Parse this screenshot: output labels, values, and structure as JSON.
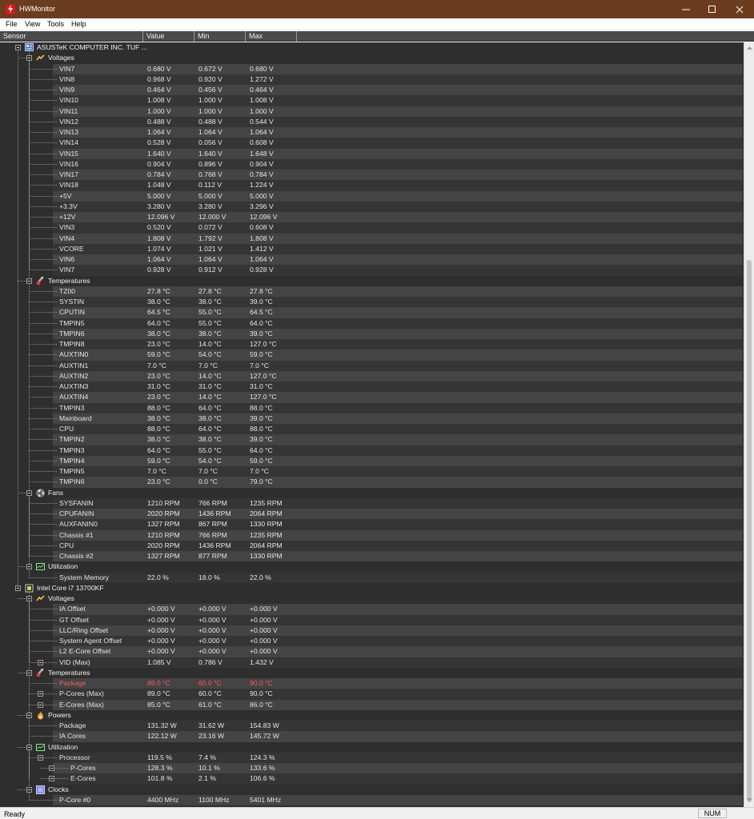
{
  "window": {
    "title": "HWMonitor"
  },
  "menu": [
    "File",
    "View",
    "Tools",
    "Help"
  ],
  "columns": {
    "sensor": "Sensor",
    "value": "Value",
    "min": "Min",
    "max": "Max"
  },
  "tree": [
    {
      "type": "device",
      "level": 0,
      "icon": "motherboard-icon",
      "label": "ASUSTeK COMPUTER INC. TUF ..."
    },
    {
      "type": "group",
      "level": 1,
      "icon": "voltage-icon",
      "label": "Voltages"
    },
    {
      "type": "sensor",
      "level": 2,
      "label": "VIN7",
      "value": "0.680 V",
      "min": "0.672 V",
      "max": "0.680 V"
    },
    {
      "type": "sensor",
      "level": 2,
      "label": "VIN8",
      "value": "0.968 V",
      "min": "0.920 V",
      "max": "1.272 V"
    },
    {
      "type": "sensor",
      "level": 2,
      "label": "VIN9",
      "value": "0.464 V",
      "min": "0.456 V",
      "max": "0.464 V"
    },
    {
      "type": "sensor",
      "level": 2,
      "label": "VIN10",
      "value": "1.008 V",
      "min": "1.000 V",
      "max": "1.008 V"
    },
    {
      "type": "sensor",
      "level": 2,
      "label": "VIN11",
      "value": "1.000 V",
      "min": "1.000 V",
      "max": "1.000 V"
    },
    {
      "type": "sensor",
      "level": 2,
      "label": "VIN12",
      "value": "0.488 V",
      "min": "0.488 V",
      "max": "0.544 V"
    },
    {
      "type": "sensor",
      "level": 2,
      "label": "VIN13",
      "value": "1.064 V",
      "min": "1.064 V",
      "max": "1.064 V"
    },
    {
      "type": "sensor",
      "level": 2,
      "label": "VIN14",
      "value": "0.528 V",
      "min": "0.056 V",
      "max": "0.608 V"
    },
    {
      "type": "sensor",
      "level": 2,
      "label": "VIN15",
      "value": "1.640 V",
      "min": "1.640 V",
      "max": "1.648 V"
    },
    {
      "type": "sensor",
      "level": 2,
      "label": "VIN16",
      "value": "0.904 V",
      "min": "0.896 V",
      "max": "0.904 V"
    },
    {
      "type": "sensor",
      "level": 2,
      "label": "VIN17",
      "value": "0.784 V",
      "min": "0.768 V",
      "max": "0.784 V"
    },
    {
      "type": "sensor",
      "level": 2,
      "label": "VIN18",
      "value": "1.048 V",
      "min": "0.112 V",
      "max": "1.224 V"
    },
    {
      "type": "sensor",
      "level": 2,
      "label": "+5V",
      "value": "5.000 V",
      "min": "5.000 V",
      "max": "5.000 V"
    },
    {
      "type": "sensor",
      "level": 2,
      "label": "+3.3V",
      "value": "3.280 V",
      "min": "3.280 V",
      "max": "3.296 V"
    },
    {
      "type": "sensor",
      "level": 2,
      "label": "+12V",
      "value": "12.096 V",
      "min": "12.000 V",
      "max": "12.096 V"
    },
    {
      "type": "sensor",
      "level": 2,
      "label": "VIN3",
      "value": "0.520 V",
      "min": "0.072 V",
      "max": "0.608 V"
    },
    {
      "type": "sensor",
      "level": 2,
      "label": "VIN4",
      "value": "1.808 V",
      "min": "1.792 V",
      "max": "1.808 V"
    },
    {
      "type": "sensor",
      "level": 2,
      "label": "VCORE",
      "value": "1.074 V",
      "min": "1.021 V",
      "max": "1.412 V"
    },
    {
      "type": "sensor",
      "level": 2,
      "label": "VIN6",
      "value": "1.064 V",
      "min": "1.064 V",
      "max": "1.064 V"
    },
    {
      "type": "sensor",
      "level": 2,
      "label": "VIN7",
      "value": "0.928 V",
      "min": "0.912 V",
      "max": "0.928 V"
    },
    {
      "type": "group",
      "level": 1,
      "icon": "thermometer-icon",
      "label": "Temperatures"
    },
    {
      "type": "sensor",
      "level": 2,
      "label": "TZ00",
      "value": "27.8 °C",
      "min": "27.8 °C",
      "max": "27.8 °C"
    },
    {
      "type": "sensor",
      "level": 2,
      "label": "SYSTIN",
      "value": "38.0 °C",
      "min": "38.0 °C",
      "max": "39.0 °C"
    },
    {
      "type": "sensor",
      "level": 2,
      "label": "CPUTIN",
      "value": "64.5 °C",
      "min": "55.0 °C",
      "max": "64.5 °C"
    },
    {
      "type": "sensor",
      "level": 2,
      "label": "TMPIN5",
      "value": "64.0 °C",
      "min": "55.0 °C",
      "max": "64.0 °C"
    },
    {
      "type": "sensor",
      "level": 2,
      "label": "TMPIN6",
      "value": "38.0 °C",
      "min": "38.0 °C",
      "max": "39.0 °C"
    },
    {
      "type": "sensor",
      "level": 2,
      "label": "TMPIN8",
      "value": "23.0 °C",
      "min": "14.0 °C",
      "max": "127.0 °C"
    },
    {
      "type": "sensor",
      "level": 2,
      "label": "AUXTIN0",
      "value": "59.0 °C",
      "min": "54.0 °C",
      "max": "59.0 °C"
    },
    {
      "type": "sensor",
      "level": 2,
      "label": "AUXTIN1",
      "value": "7.0 °C",
      "min": "7.0 °C",
      "max": "7.0 °C"
    },
    {
      "type": "sensor",
      "level": 2,
      "label": "AUXTIN2",
      "value": "23.0 °C",
      "min": "14.0 °C",
      "max": "127.0 °C"
    },
    {
      "type": "sensor",
      "level": 2,
      "label": "AUXTIN3",
      "value": "31.0 °C",
      "min": "31.0 °C",
      "max": "31.0 °C"
    },
    {
      "type": "sensor",
      "level": 2,
      "label": "AUXTIN4",
      "value": "23.0 °C",
      "min": "14.0 °C",
      "max": "127.0 °C"
    },
    {
      "type": "sensor",
      "level": 2,
      "label": "TMPIN3",
      "value": "88.0 °C",
      "min": "64.0 °C",
      "max": "88.0 °C"
    },
    {
      "type": "sensor",
      "level": 2,
      "label": "Mainboard",
      "value": "38.0 °C",
      "min": "38.0 °C",
      "max": "39.0 °C"
    },
    {
      "type": "sensor",
      "level": 2,
      "label": "CPU",
      "value": "88.0 °C",
      "min": "64.0 °C",
      "max": "88.0 °C"
    },
    {
      "type": "sensor",
      "level": 2,
      "label": "TMPIN2",
      "value": "38.0 °C",
      "min": "38.0 °C",
      "max": "39.0 °C"
    },
    {
      "type": "sensor",
      "level": 2,
      "label": "TMPIN3",
      "value": "64.0 °C",
      "min": "55.0 °C",
      "max": "64.0 °C"
    },
    {
      "type": "sensor",
      "level": 2,
      "label": "TMPIN4",
      "value": "59.0 °C",
      "min": "54.0 °C",
      "max": "59.0 °C"
    },
    {
      "type": "sensor",
      "level": 2,
      "label": "TMPIN5",
      "value": "7.0 °C",
      "min": "7.0 °C",
      "max": "7.0 °C"
    },
    {
      "type": "sensor",
      "level": 2,
      "label": "TMPIN6",
      "value": "23.0 °C",
      "min": "0.0 °C",
      "max": "79.0 °C"
    },
    {
      "type": "group",
      "level": 1,
      "icon": "fan-icon",
      "label": "Fans"
    },
    {
      "type": "sensor",
      "level": 2,
      "label": "SYSFANIN",
      "value": "1210 RPM",
      "min": "766 RPM",
      "max": "1235 RPM"
    },
    {
      "type": "sensor",
      "level": 2,
      "label": "CPUFANIN",
      "value": "2020 RPM",
      "min": "1436 RPM",
      "max": "2064 RPM"
    },
    {
      "type": "sensor",
      "level": 2,
      "label": "AUXFANIN0",
      "value": "1327 RPM",
      "min": "867 RPM",
      "max": "1330 RPM"
    },
    {
      "type": "sensor",
      "level": 2,
      "label": "Chassis #1",
      "value": "1210 RPM",
      "min": "766 RPM",
      "max": "1235 RPM"
    },
    {
      "type": "sensor",
      "level": 2,
      "label": "CPU",
      "value": "2020 RPM",
      "min": "1436 RPM",
      "max": "2064 RPM"
    },
    {
      "type": "sensor",
      "level": 2,
      "label": "Chassis #2",
      "value": "1327 RPM",
      "min": "877 RPM",
      "max": "1330 RPM"
    },
    {
      "type": "group",
      "level": 1,
      "icon": "utilization-icon",
      "label": "Utilization"
    },
    {
      "type": "sensor",
      "level": 2,
      "label": "System Memory",
      "value": "22.0 %",
      "min": "18.0 %",
      "max": "22.0 %"
    },
    {
      "type": "device",
      "level": 0,
      "icon": "cpu-icon",
      "label": "Intel Core i7 13700KF"
    },
    {
      "type": "group",
      "level": 1,
      "icon": "voltage-icon",
      "label": "Voltages"
    },
    {
      "type": "sensor",
      "level": 2,
      "label": "IA Offset",
      "value": "+0.000 V",
      "min": "+0.000 V",
      "max": "+0.000 V"
    },
    {
      "type": "sensor",
      "level": 2,
      "label": "GT Offset",
      "value": "+0.000 V",
      "min": "+0.000 V",
      "max": "+0.000 V"
    },
    {
      "type": "sensor",
      "level": 2,
      "label": "LLC/Ring Offset",
      "value": "+0.000 V",
      "min": "+0.000 V",
      "max": "+0.000 V"
    },
    {
      "type": "sensor",
      "level": 2,
      "label": "System Agent Offset",
      "value": "+0.000 V",
      "min": "+0.000 V",
      "max": "+0.000 V"
    },
    {
      "type": "sensor",
      "level": 2,
      "label": "L2 E-Core Offset",
      "value": "+0.000 V",
      "min": "+0.000 V",
      "max": "+0.000 V"
    },
    {
      "type": "sensor",
      "level": 2,
      "expandable": true,
      "label": "VID (Max)",
      "value": "1.085 V",
      "min": "0.786 V",
      "max": "1.432 V"
    },
    {
      "type": "group",
      "level": 1,
      "icon": "thermometer-icon",
      "label": "Temperatures"
    },
    {
      "type": "sensor",
      "level": 2,
      "alert": true,
      "label": "Package",
      "value": "89.0 °C",
      "min": "60.0 °C",
      "max": "90.0 °C"
    },
    {
      "type": "sensor",
      "level": 2,
      "expandable": true,
      "label": "P-Cores (Max)",
      "value": "89.0 °C",
      "min": "60.0 °C",
      "max": "90.0 °C"
    },
    {
      "type": "sensor",
      "level": 2,
      "expandable": true,
      "label": "E-Cores (Max)",
      "value": "85.0 °C",
      "min": "61.0 °C",
      "max": "86.0 °C"
    },
    {
      "type": "group",
      "level": 1,
      "icon": "flame-icon",
      "label": "Powers"
    },
    {
      "type": "sensor",
      "level": 2,
      "label": "Package",
      "value": "131.32 W",
      "min": "31.62 W",
      "max": "154.83 W"
    },
    {
      "type": "sensor",
      "level": 2,
      "label": "IA Cores",
      "value": "122.12 W",
      "min": "23.16 W",
      "max": "145.72 W"
    },
    {
      "type": "group",
      "level": 1,
      "icon": "utilization-icon",
      "label": "Utilization"
    },
    {
      "type": "sensor",
      "level": 2,
      "expandable": true,
      "label": "Processor",
      "value": "119.5 %",
      "min": "7.4 %",
      "max": "124.3 %"
    },
    {
      "type": "sensor",
      "level": 3,
      "expandable": true,
      "label": "P-Cores",
      "value": "128.3 %",
      "min": "10.1 %",
      "max": "133.6 %"
    },
    {
      "type": "sensor",
      "level": 3,
      "expandable": true,
      "label": "E-Cores",
      "value": "101.8 %",
      "min": "2.1 %",
      "max": "106.6 %"
    },
    {
      "type": "group",
      "level": 1,
      "icon": "clock-icon",
      "label": "Clocks"
    },
    {
      "type": "sensor",
      "level": 2,
      "label": "P-Core #0",
      "value": "4400 MHz",
      "min": "1100 MHz",
      "max": "5401 MHz"
    }
  ],
  "status": {
    "text": "Ready",
    "indicator": "NUM"
  },
  "colors": {
    "titlebar": "#6b3c1d",
    "panel": "#2e2e2e",
    "row_even": "#444444",
    "row_odd": "#353535",
    "alert": "#ff5a5a"
  }
}
